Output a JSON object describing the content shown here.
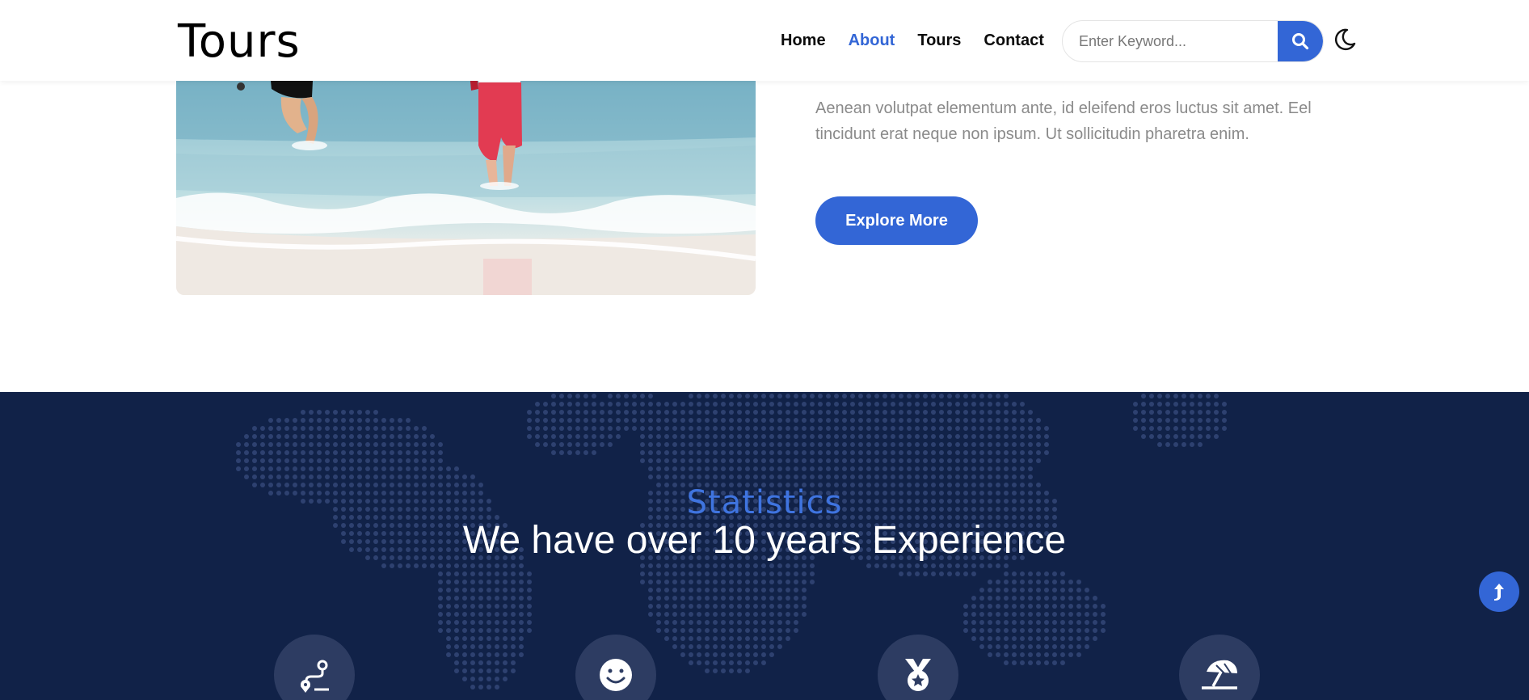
{
  "header": {
    "logo": "Tours",
    "nav": [
      "Home",
      "About",
      "Tours",
      "Contact"
    ],
    "active_nav": "About",
    "search_placeholder": "Enter Keyword..."
  },
  "hero": {
    "text": "Aenean volutpat elementum ante, id eleifend eros luctus sit amet. Eel tincidunt erat neque non ipsum. Ut sollicitudin pharetra enim.",
    "button_label": "Explore More"
  },
  "stats": {
    "label": "Statistics",
    "title": "We have over 10 years Experience",
    "icons": [
      "route-icon",
      "smile-icon",
      "medal-icon",
      "beach-umbrella-icon"
    ]
  },
  "colors": {
    "accent": "#3366d6",
    "stats_bg": "#112248",
    "icon_circle": "#2d3c62"
  }
}
